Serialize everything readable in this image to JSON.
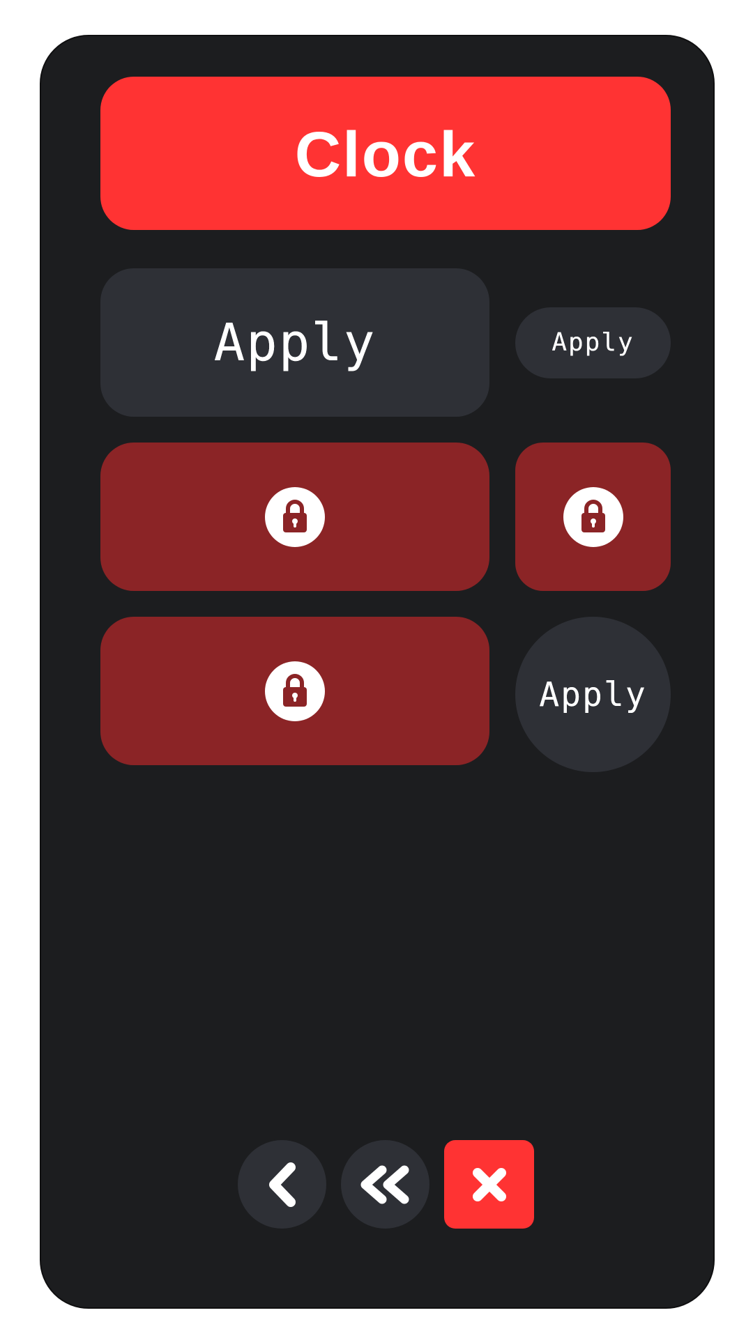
{
  "header": {
    "title": "Clock",
    "color": "#ff3333"
  },
  "buttons": {
    "apply_label": "Apply"
  },
  "colors": {
    "background": "#1c1d1f",
    "dark_button": "#2e3036",
    "locked_button": "#8b2426",
    "accent": "#ff3333",
    "icon": "#ffffff"
  },
  "icons": {
    "lock": "lock-icon",
    "back": "chevron-left-icon",
    "rewind": "double-chevron-left-icon",
    "close": "close-icon"
  }
}
